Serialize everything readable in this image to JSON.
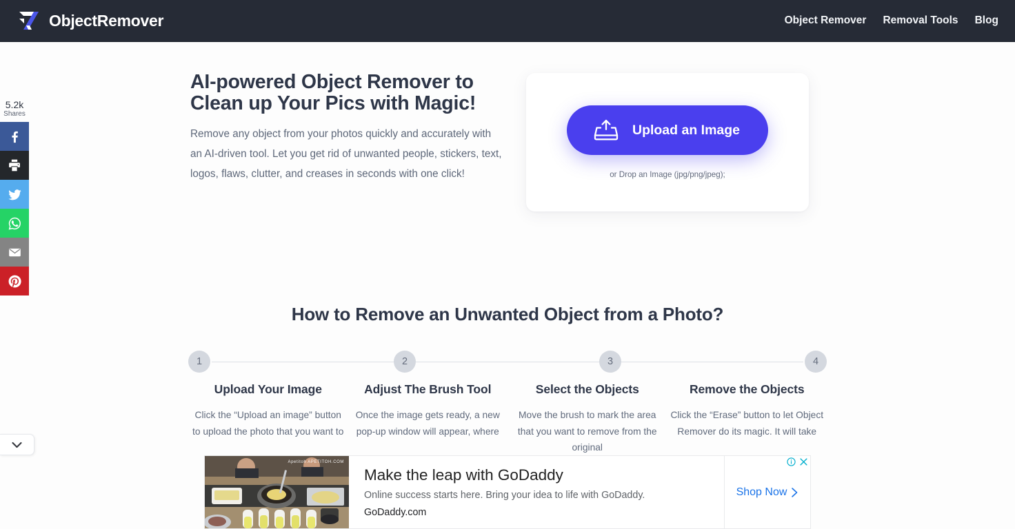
{
  "header": {
    "brand_name": "ObjectRemover",
    "logo_icon": "r-monogram-logo-icon",
    "nav": [
      {
        "label": "Object Remover"
      },
      {
        "label": "Removal Tools"
      },
      {
        "label": "Blog"
      }
    ]
  },
  "share_rail": {
    "count": "5.2k",
    "count_label": "Shares",
    "buttons": [
      {
        "name": "facebook",
        "icon": "facebook-icon",
        "color": "#3b5998"
      },
      {
        "name": "print",
        "icon": "printer-icon",
        "color": "#24272b"
      },
      {
        "name": "twitter",
        "icon": "twitter-bird-icon",
        "color": "#55acee"
      },
      {
        "name": "whatsapp",
        "icon": "whatsapp-icon",
        "color": "#25d366"
      },
      {
        "name": "email",
        "icon": "envelope-icon",
        "color": "#848484"
      },
      {
        "name": "pinterest",
        "icon": "pinterest-icon",
        "color": "#cb2027"
      }
    ],
    "toggle_icon": "chevron-down-icon"
  },
  "hero": {
    "title": "AI-powered Object Remover to Clean up Your Pics with Magic!",
    "subtitle": "Remove any object from your photos quickly and accurately with an AI-driven tool. Let you get rid of unwanted people, stickers, text, logos, flaws, clutter, and creases in seconds with one click!",
    "upload_button_label": "Upload an Image",
    "upload_button_icon": "upload-tray-icon",
    "upload_button_color": "#4a3fee",
    "drop_hint": "or Drop an Image (jpg/png/jpeg);"
  },
  "howto": {
    "title": "How to Remove an Unwanted Object from a Photo?",
    "steps": [
      {
        "number": "1",
        "heading": "Upload Your Image",
        "text": "Click the “Upload an image” button to upload the photo that you want to"
      },
      {
        "number": "2",
        "heading": "Adjust The Brush Tool",
        "text": "Once the image gets ready, a new pop-up window will appear, where"
      },
      {
        "number": "3",
        "heading": "Select the Objects",
        "text": "Move the brush to mark the area that you want to remove from the original"
      },
      {
        "number": "4",
        "heading": "Remove the Objects",
        "text": "Click the “Erase” button to let Object Remover do its magic. It will take"
      }
    ]
  },
  "ad": {
    "headline": "Make the leap with GoDaddy",
    "description": "Online success starts here. Bring your idea to life with GoDaddy.",
    "url": "GoDaddy.com",
    "cta_label": "Shop Now",
    "cta_icon": "chevron-right-icon",
    "info_icon": "ad-info-icon",
    "close_icon": "ad-close-icon",
    "thumb_watermark": "Apetitoh\nAPETITOH.COM"
  }
}
